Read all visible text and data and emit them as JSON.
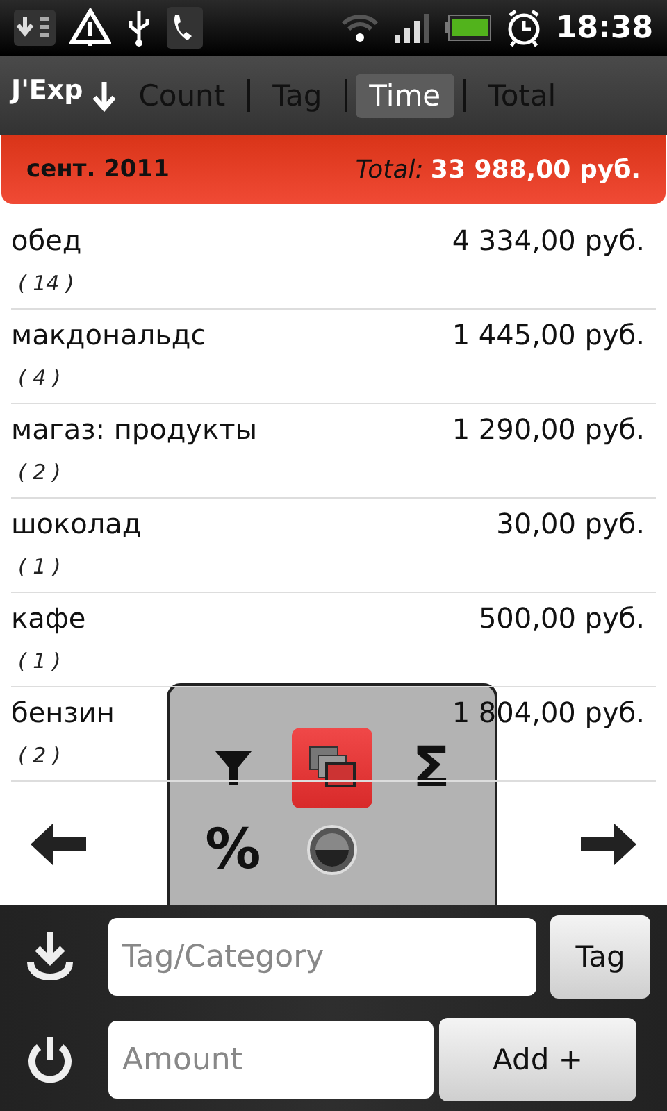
{
  "status_bar": {
    "time": "18:38"
  },
  "toolbar": {
    "title": "J'Exp",
    "tabs": [
      {
        "label": "Count",
        "selected": false
      },
      {
        "label": "Tag",
        "selected": false
      },
      {
        "label": "Time",
        "selected": true
      },
      {
        "label": "Total",
        "selected": false
      }
    ]
  },
  "summary": {
    "period": "сент. 2011",
    "total_label": "Total:",
    "total": "33 988,00 руб."
  },
  "rows": [
    {
      "name": "обед",
      "count": "( 14 )",
      "amount": "4 334,00 руб."
    },
    {
      "name": "макдональдс",
      "count": "( 4 )",
      "amount": "1 445,00 руб."
    },
    {
      "name": "магаз: продукты",
      "count": "( 2 )",
      "amount": "1 290,00 руб."
    },
    {
      "name": "шоколад",
      "count": "( 1 )",
      "amount": "30,00 руб."
    },
    {
      "name": "кафе",
      "count": "( 1 )",
      "amount": "500,00 руб."
    },
    {
      "name": "бензин",
      "count": "( 2 )",
      "amount": "1 804,00 руб."
    }
  ],
  "popup": {
    "items": [
      {
        "kind": "filter",
        "selected": false
      },
      {
        "kind": "windows",
        "selected": true
      },
      {
        "kind": "glyph",
        "glyph": "Σ",
        "selected": false
      },
      {
        "kind": "glyph",
        "glyph": "%",
        "selected": false
      },
      {
        "kind": "dial",
        "selected": false
      }
    ]
  },
  "form": {
    "tag_placeholder": "Tag/Category",
    "tag_button": "Tag",
    "amount_placeholder": "Amount",
    "add_button": "Add +"
  }
}
